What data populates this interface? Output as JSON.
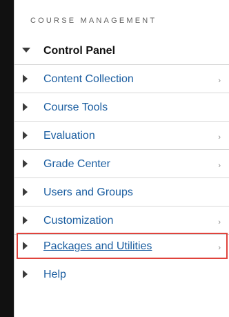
{
  "menu": {
    "header": "COURSE MANAGEMENT",
    "items": [
      {
        "label": "Control Panel",
        "expanded": true,
        "has_submenu": false,
        "bold": true,
        "color": "#111111"
      },
      {
        "label": "Content Collection",
        "expanded": false,
        "has_submenu": true,
        "chevron": "›",
        "color": "#1a5da0"
      },
      {
        "label": "Course Tools",
        "expanded": false,
        "has_submenu": false,
        "color": "#1a5da0"
      },
      {
        "label": "Evaluation",
        "expanded": false,
        "has_submenu": true,
        "chevron": "›",
        "color": "#1a5da0"
      },
      {
        "label": "Grade Center",
        "expanded": false,
        "has_submenu": true,
        "chevron": "›",
        "color": "#1a5da0"
      },
      {
        "label": "Users and Groups",
        "expanded": false,
        "has_submenu": false,
        "color": "#1a5da0"
      },
      {
        "label": "Customization",
        "expanded": false,
        "has_submenu": true,
        "chevron": "›",
        "color": "#1a5da0"
      },
      {
        "label": "Packages and Utilities",
        "expanded": false,
        "has_submenu": true,
        "chevron": "›",
        "highlighted": true,
        "color": "#1a5da0"
      },
      {
        "label": "Help",
        "expanded": false,
        "has_submenu": false,
        "color": "#1a5da0"
      }
    ]
  },
  "colors": {
    "highlight_border": "#e0433c",
    "link": "#1a5da0",
    "left_bar": "#111111"
  }
}
